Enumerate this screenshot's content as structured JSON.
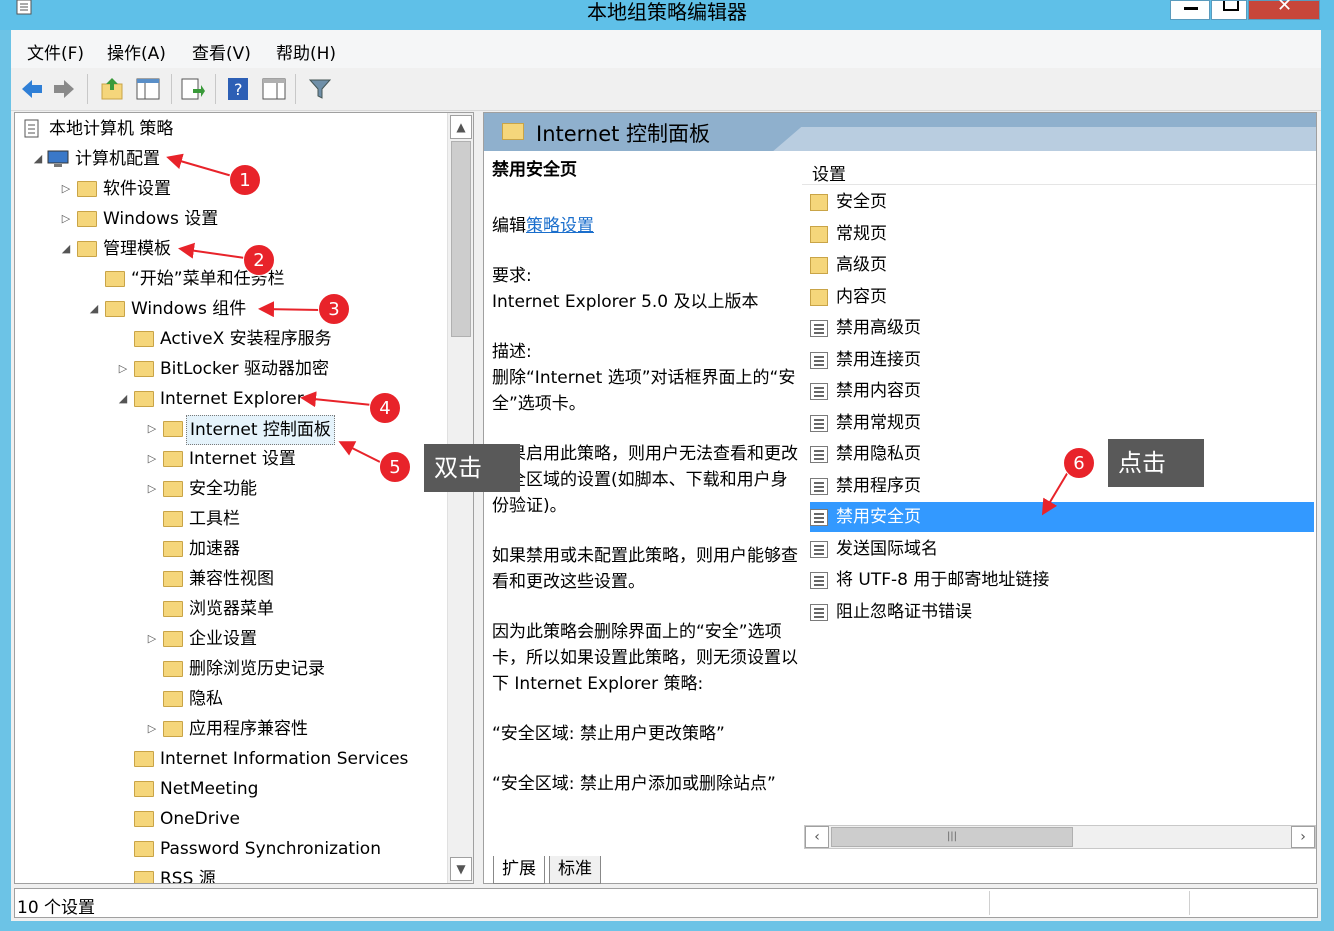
{
  "window": {
    "title": "本地组策略编辑器"
  },
  "menu": [
    {
      "label": "文件(F)"
    },
    {
      "label": "操作(A)"
    },
    {
      "label": "查看(V)"
    },
    {
      "label": "帮助(H)"
    }
  ],
  "tree": [
    {
      "label": "本地计算机 策略",
      "level": 0,
      "expander": "none",
      "icon": "policy"
    },
    {
      "label": "计算机配置",
      "level": 1,
      "expander": "open",
      "icon": "computer"
    },
    {
      "label": "软件设置",
      "level": 2,
      "expander": "closed",
      "icon": "folder"
    },
    {
      "label": "Windows 设置",
      "level": 2,
      "expander": "closed",
      "icon": "folder"
    },
    {
      "label": "管理模板",
      "level": 2,
      "expander": "open",
      "icon": "folder"
    },
    {
      "label": "“开始”菜单和任务栏",
      "level": 3,
      "expander": "none",
      "icon": "folder"
    },
    {
      "label": "Windows 组件",
      "level": 3,
      "expander": "open",
      "icon": "folder"
    },
    {
      "label": "ActiveX 安装程序服务",
      "level": 4,
      "expander": "none",
      "icon": "folder"
    },
    {
      "label": "BitLocker 驱动器加密",
      "level": 4,
      "expander": "closed",
      "icon": "folder"
    },
    {
      "label": "Internet Explorer",
      "level": 4,
      "expander": "open",
      "icon": "folder"
    },
    {
      "label": "Internet 控制面板",
      "level": 5,
      "expander": "closed",
      "icon": "folder",
      "selected": true
    },
    {
      "label": "Internet 设置",
      "level": 5,
      "expander": "closed",
      "icon": "folder"
    },
    {
      "label": "安全功能",
      "level": 5,
      "expander": "closed",
      "icon": "folder"
    },
    {
      "label": "工具栏",
      "level": 5,
      "expander": "none",
      "icon": "folder"
    },
    {
      "label": "加速器",
      "level": 5,
      "expander": "none",
      "icon": "folder"
    },
    {
      "label": "兼容性视图",
      "level": 5,
      "expander": "none",
      "icon": "folder"
    },
    {
      "label": "浏览器菜单",
      "level": 5,
      "expander": "none",
      "icon": "folder"
    },
    {
      "label": "企业设置",
      "level": 5,
      "expander": "closed",
      "icon": "folder"
    },
    {
      "label": "删除浏览历史记录",
      "level": 5,
      "expander": "none",
      "icon": "folder"
    },
    {
      "label": "隐私",
      "level": 5,
      "expander": "none",
      "icon": "folder"
    },
    {
      "label": "应用程序兼容性",
      "level": 5,
      "expander": "closed",
      "icon": "folder"
    },
    {
      "label": "Internet Information Services",
      "level": 4,
      "expander": "none",
      "icon": "folder"
    },
    {
      "label": "NetMeeting",
      "level": 4,
      "expander": "none",
      "icon": "folder"
    },
    {
      "label": "OneDrive",
      "level": 4,
      "expander": "none",
      "icon": "folder"
    },
    {
      "label": "Password Synchronization",
      "level": 4,
      "expander": "none",
      "icon": "folder"
    },
    {
      "label": "RSS 源",
      "level": 4,
      "expander": "none",
      "icon": "folder"
    }
  ],
  "right": {
    "header": "Internet 控制面板",
    "description": {
      "title": "禁用安全页",
      "edit_prefix": "编辑",
      "edit_link": "策略设置",
      "req_label": "要求:",
      "req_value": "Internet Explorer 5.0 及以上版本",
      "desc_label": "描述:",
      "desc_value": "删除“Internet 选项”对话框界面上的“安全”选项卡。",
      "para1": "如果启用此策略，则用户无法查看和更改安全区域的设置(如脚本、下载和用户身份验证)。",
      "para2": "如果禁用或未配置此策略，则用户能够查看和更改这些设置。",
      "para3": "因为此策略会删除界面上的“安全”选项卡，所以如果设置此策略，则无须设置以下 Internet Explorer 策略:",
      "para4": "“安全区域: 禁止用户更改策略”",
      "para5": "“安全区域: 禁止用户添加或删除站点”"
    },
    "list_header": "设置",
    "items": [
      {
        "label": "安全页",
        "icon": "folder"
      },
      {
        "label": "常规页",
        "icon": "folder"
      },
      {
        "label": "高级页",
        "icon": "folder"
      },
      {
        "label": "内容页",
        "icon": "folder"
      },
      {
        "label": "禁用高级页",
        "icon": "policy"
      },
      {
        "label": "禁用连接页",
        "icon": "policy"
      },
      {
        "label": "禁用内容页",
        "icon": "policy"
      },
      {
        "label": "禁用常规页",
        "icon": "policy"
      },
      {
        "label": "禁用隐私页",
        "icon": "policy"
      },
      {
        "label": "禁用程序页",
        "icon": "policy"
      },
      {
        "label": "禁用安全页",
        "icon": "policy",
        "selected": true
      },
      {
        "label": "发送国际域名",
        "icon": "policy"
      },
      {
        "label": "将 UTF-8 用于邮寄地址链接",
        "icon": "policy"
      },
      {
        "label": "阻止忽略证书错误",
        "icon": "policy"
      }
    ],
    "tabs": [
      {
        "label": "扩展"
      },
      {
        "label": "标准"
      }
    ]
  },
  "status": {
    "text": "10 个设置"
  },
  "annotations": {
    "badges": [
      "1",
      "2",
      "3",
      "4",
      "5",
      "6"
    ],
    "callout_dblclick": "双击",
    "callout_click": "点击",
    "badge_color": "#e8232a",
    "callout_color": "#595959"
  },
  "colors": {
    "titlebar": "#5fc0e8",
    "selection": "#3399ff",
    "link": "#1a6ecc",
    "folder": "#f5d67b"
  }
}
